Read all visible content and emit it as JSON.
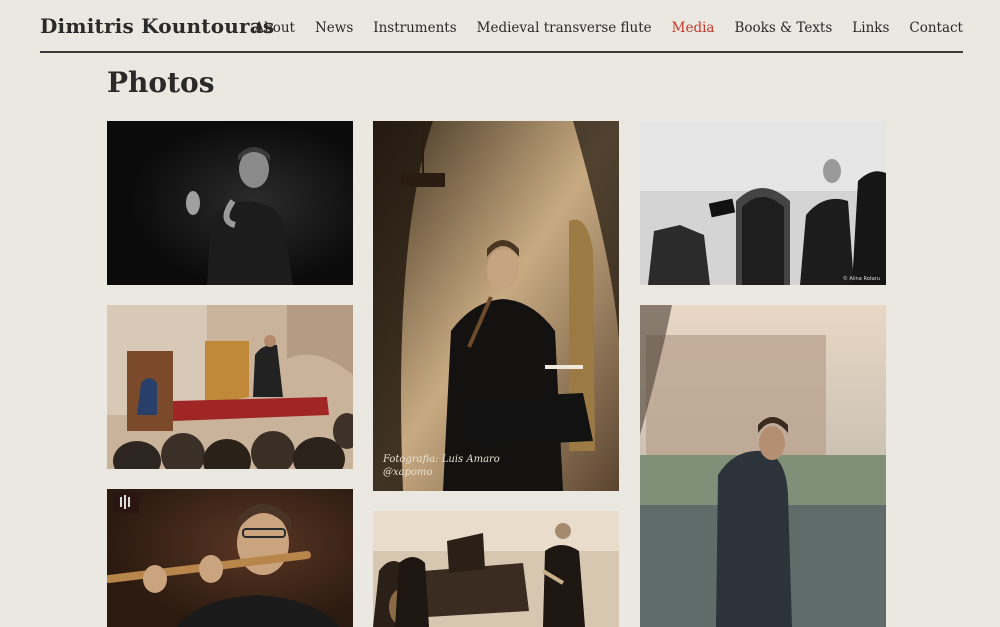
{
  "site": {
    "title": "Dimitris Kountouras"
  },
  "nav": {
    "items": [
      "About",
      "News",
      "Instruments",
      "Medieval transverse flute",
      "Media",
      "Books & Texts",
      "Links",
      "Contact"
    ],
    "active": "Media"
  },
  "page": {
    "title": "Photos"
  },
  "photos": {
    "p2": {
      "caption_line1": "Fotografia: Luis Amaro",
      "caption_line2": "@xapomo"
    },
    "p3": {
      "credit": "© Alina Rotaru"
    }
  },
  "colors": {
    "accent": "#c0392b",
    "background": "#ebe7e1"
  }
}
